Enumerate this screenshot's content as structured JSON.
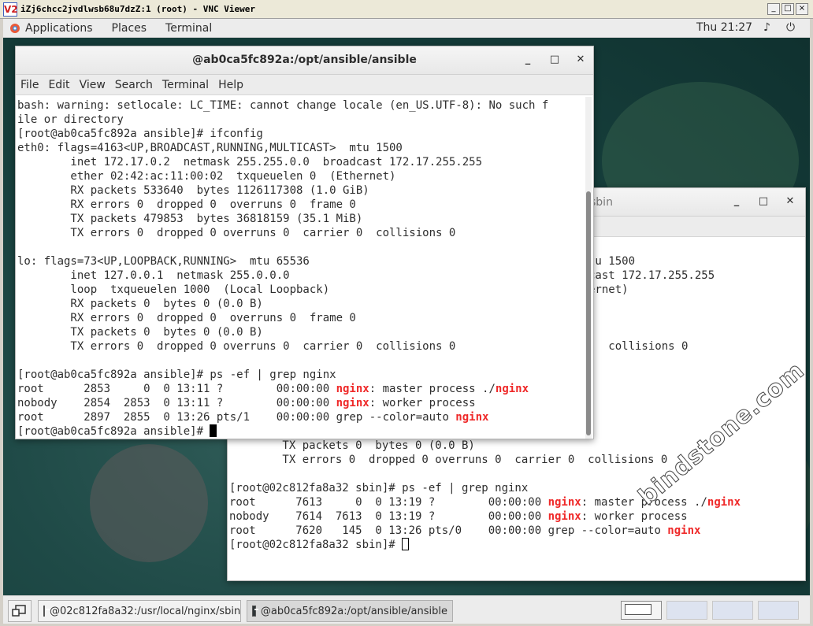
{
  "vnc": {
    "title": "iZj6chcc2jvdlwsb68u7dzZ:1 (root) - VNC Viewer",
    "logo": "V2"
  },
  "top_panel": {
    "applications": "Applications",
    "places": "Places",
    "terminal": "Terminal",
    "clock": "Thu 21:27",
    "volume_icon": "♪",
    "power_icon": "⏻"
  },
  "front_window": {
    "title": "@ab0ca5fc892a:/opt/ansible/ansible",
    "menu": [
      "File",
      "Edit",
      "View",
      "Search",
      "Terminal",
      "Help"
    ],
    "lines": [
      "bash: warning: setlocale: LC_TIME: cannot change locale (en_US.UTF-8): No such f",
      "ile or directory",
      "[root@ab0ca5fc892a ansible]# ifconfig",
      "eth0: flags=4163<UP,BROADCAST,RUNNING,MULTICAST>  mtu 1500",
      "        inet 172.17.0.2  netmask 255.255.0.0  broadcast 172.17.255.255",
      "        ether 02:42:ac:11:00:02  txqueuelen 0  (Ethernet)",
      "        RX packets 533640  bytes 1126117308 (1.0 GiB)",
      "        RX errors 0  dropped 0  overruns 0  frame 0",
      "        TX packets 479853  bytes 36818159 (35.1 MiB)",
      "        TX errors 0  dropped 0 overruns 0  carrier 0  collisions 0",
      "",
      "lo: flags=73<UP,LOOPBACK,RUNNING>  mtu 65536",
      "        inet 127.0.0.1  netmask 255.0.0.0",
      "        loop  txqueuelen 1000  (Local Loopback)",
      "        RX packets 0  bytes 0 (0.0 B)",
      "        RX errors 0  dropped 0  overruns 0  frame 0",
      "        TX packets 0  bytes 0 (0.0 B)",
      "        TX errors 0  dropped 0 overruns 0  carrier 0  collisions 0",
      "",
      "[root@ab0ca5fc892a ansible]# ps -ef | grep nginx"
    ],
    "ps_rows": [
      {
        "pre": "root      2853     0  0 13:11 ?        00:00:00 ",
        "hl1": "nginx",
        "mid": ": master process ./",
        "hl2": "nginx"
      },
      {
        "pre": "nobody    2854  2853  0 13:11 ?        00:00:00 ",
        "hl1": "nginx",
        "mid": ": worker process",
        "hl2": ""
      },
      {
        "pre": "root      2897  2855  0 13:26 pts/1    00:00:00 grep --color=auto ",
        "hl1": "nginx",
        "mid": "",
        "hl2": ""
      }
    ],
    "prompt": "[root@ab0ca5fc892a ansible]# "
  },
  "back_window": {
    "title_fragment": "sbin",
    "right_fragments": [
      "tu 1500",
      "cast 172.17.255.255",
      "ernet)",
      "",
      "",
      "",
      ")  collisions 0"
    ],
    "lines": [
      "        TX packets 0  bytes 0 (0.0 B)",
      "        TX errors 0  dropped 0 overruns 0  carrier 0  collisions 0",
      "",
      "[root@02c812fa8a32 sbin]# ps -ef | grep nginx"
    ],
    "ps_rows": [
      {
        "pre": "root      7613     0  0 13:19 ?        00:00:00 ",
        "hl1": "nginx",
        "mid": ": master process ./",
        "hl2": "nginx"
      },
      {
        "pre": "nobody    7614  7613  0 13:19 ?        00:00:00 ",
        "hl1": "nginx",
        "mid": ": worker process",
        "hl2": ""
      },
      {
        "pre": "root      7620   145  0 13:26 pts/0    00:00:00 grep --color=auto ",
        "hl1": "nginx",
        "mid": "",
        "hl2": ""
      }
    ],
    "prompt": "[root@02c812fa8a32 sbin]# "
  },
  "taskbar": {
    "task1": "@02c812fa8a32:/usr/local/nginx/sbin",
    "task2": "@ab0ca5fc892a:/opt/ansible/ansible"
  },
  "watermark": "bindstone.com",
  "colors": {
    "highlight": "#ef2929",
    "desktop": "#17403d"
  }
}
